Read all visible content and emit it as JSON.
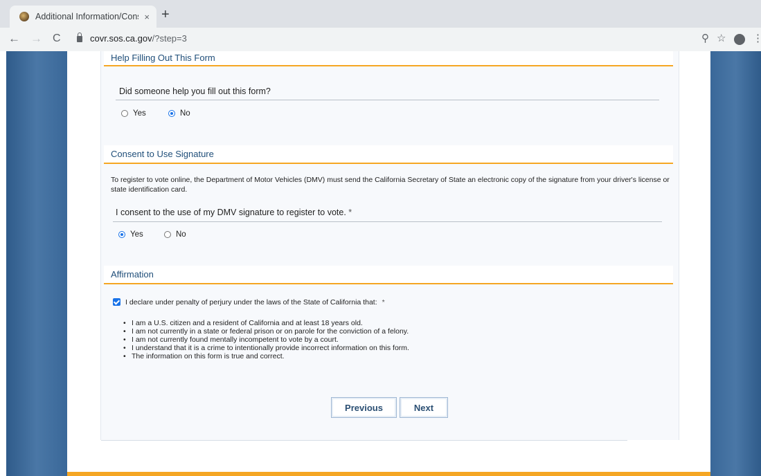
{
  "browser": {
    "tab_title": "Additional Information/Consen",
    "tab_close": "×",
    "new_tab": "+",
    "back": "←",
    "forward": "→",
    "reload": "C",
    "url_host": "covr.sos.ca.gov",
    "url_path": "/?step=3",
    "zoom": "⚲",
    "bookmark": "☆",
    "menu": "⋮"
  },
  "help_section": {
    "title": "Help Filling Out This Form",
    "question": "Did someone help you fill out this form?",
    "options": [
      {
        "label": "Yes",
        "checked": false
      },
      {
        "label": "No",
        "checked": true
      }
    ]
  },
  "consent_section": {
    "title": "Consent to Use Signature",
    "description": "To register to vote online, the Department of Motor Vehicles (DMV) must send the California Secretary of State an electronic copy of the signature from your driver's license or state identification card.",
    "question": "I consent to the use of my DMV signature to register to vote.",
    "required_mark": "*",
    "options": [
      {
        "label": "Yes",
        "checked": true
      },
      {
        "label": "No",
        "checked": false
      }
    ]
  },
  "affirmation_section": {
    "title": "Affirmation",
    "declaration": "I declare under penalty of perjury under the laws of the State of California that:",
    "required_mark": "*",
    "checked": true,
    "items": [
      "I am a U.S. citizen and a resident of California and at least 18 years old.",
      "I am not currently in a state or federal prison or on parole for the conviction of a felony.",
      "I am not currently found mentally incompetent to vote by a court.",
      "I understand that it is a crime to intentionally provide incorrect information on this form.",
      "The information on this form is true and correct."
    ]
  },
  "buttons": {
    "previous": "Previous",
    "next": "Next"
  }
}
